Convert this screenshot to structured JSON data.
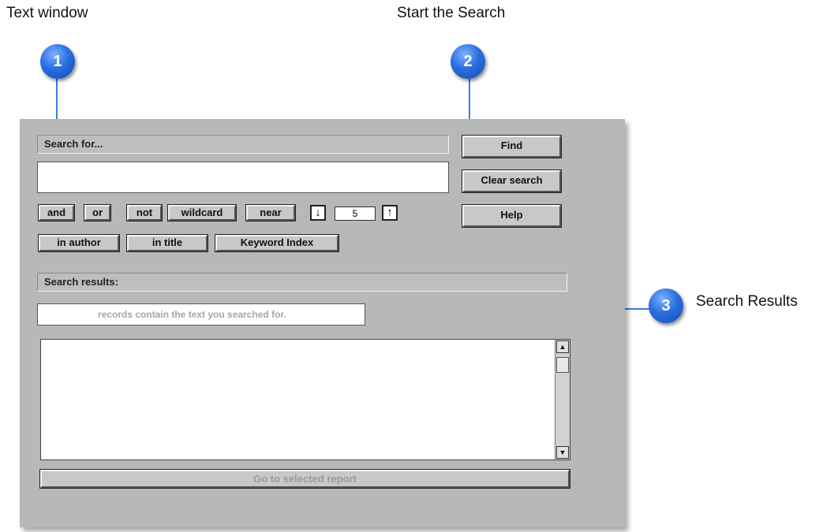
{
  "callouts": [
    {
      "number": "1",
      "label": "Text window"
    },
    {
      "number": "2",
      "label": "Start the Search"
    },
    {
      "number": "3",
      "label": "Search Results"
    }
  ],
  "search": {
    "header": "Search for...",
    "query": "",
    "operators": {
      "and": "and",
      "or": "or",
      "not": "not",
      "wildcard": "wildcard",
      "near": "near"
    },
    "near_down_icon": "↓",
    "near_value": "5",
    "near_up_icon": "↑",
    "scopes": {
      "in_author": "in author",
      "in_title": "in title",
      "keyword_index": "Keyword Index"
    }
  },
  "actions": {
    "find": "Find",
    "clear": "Clear search",
    "help": "Help"
  },
  "results": {
    "header": "Search results:",
    "count_text": "records contain the text you searched for.",
    "items": [],
    "go_button": "Go to selected report"
  },
  "colors": {
    "accent": "#2a6fe0",
    "panel": "#b8b8b8"
  }
}
